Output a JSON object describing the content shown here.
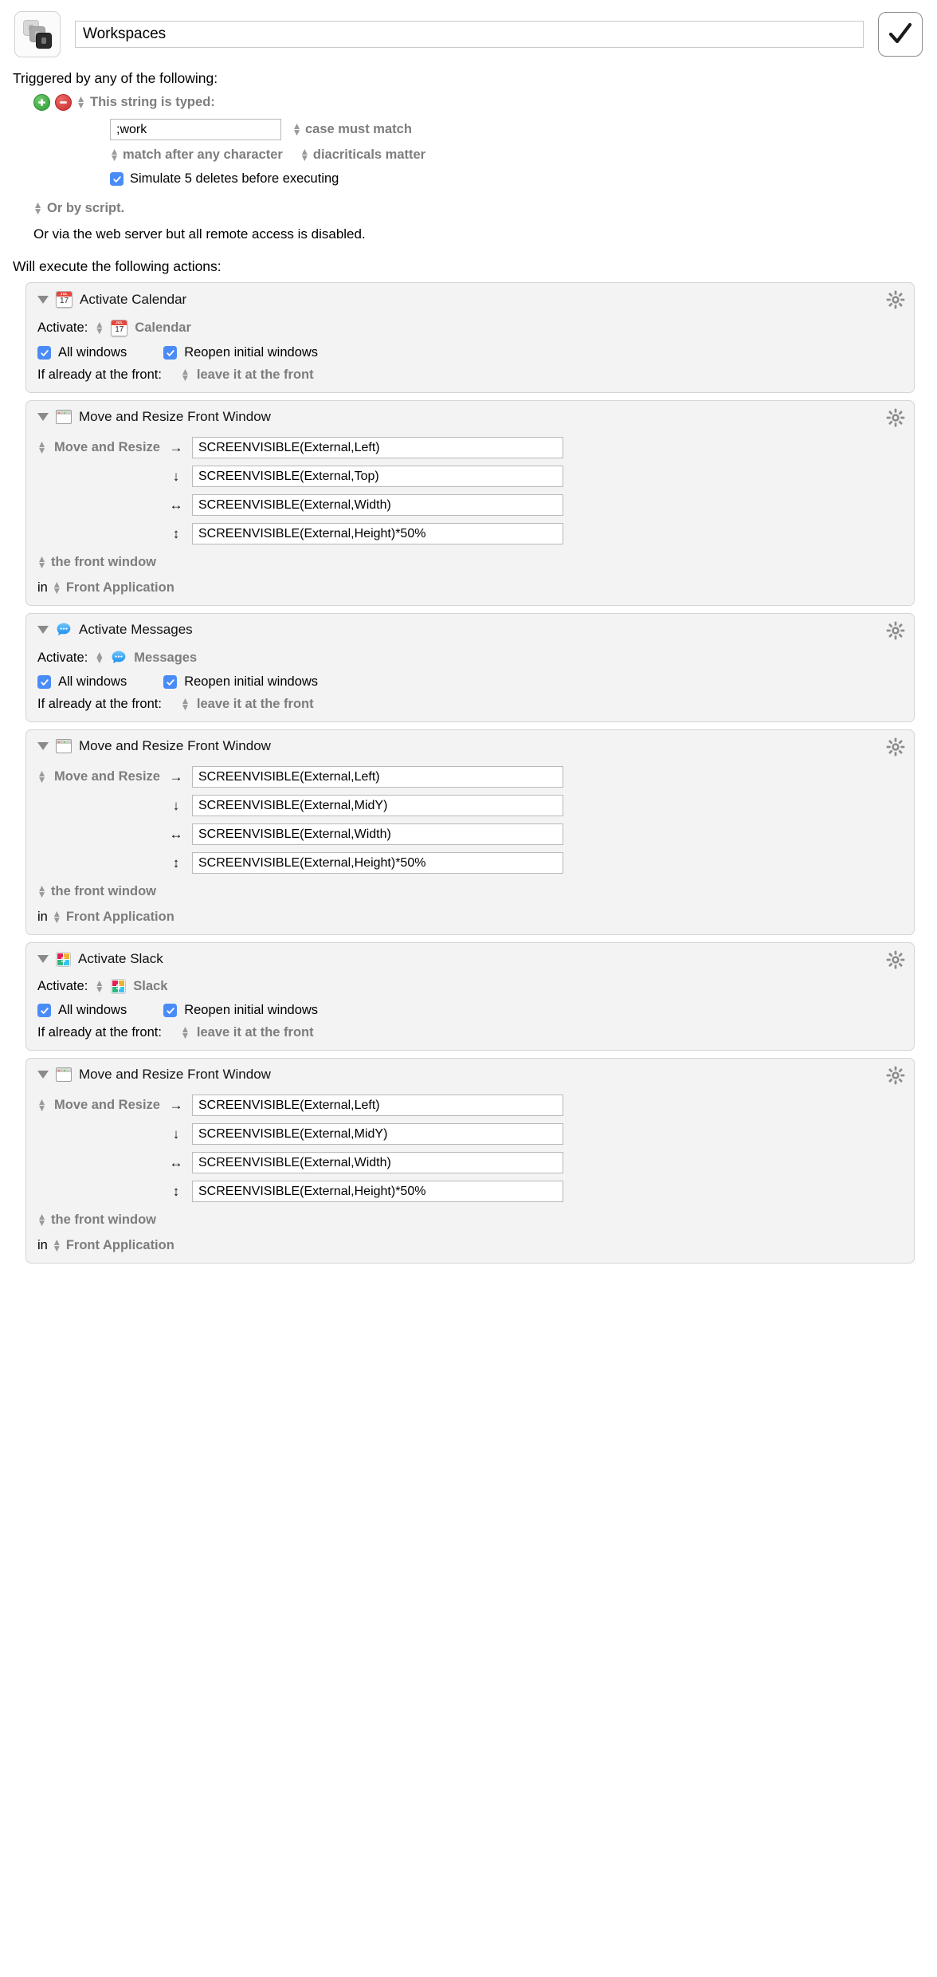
{
  "header": {
    "macro_icon": "macro-keys-icon",
    "title_value": "Workspaces",
    "title_placeholder": "Macro Name",
    "confirm_icon": "checkmark-icon"
  },
  "trigger_section": {
    "heading": "Triggered by any of the following:",
    "add_button": "+",
    "remove_button": "−",
    "trigger_type": "This string is typed:",
    "typed_string": "",
    "typed_string_value": ";work",
    "case_option": "case must match",
    "match_option": "match after any character",
    "diacriticals_option": "diacriticals matter",
    "simulate_deletes": "Simulate 5 deletes before executing",
    "simulate_deletes_checked": true,
    "script_trigger": "Or by script.",
    "web_server_note": "Or via the web server but all remote access is disabled."
  },
  "actions_section": {
    "heading": "Will execute the following actions:",
    "actions": [
      {
        "type": "activate",
        "icon": "calendar-icon",
        "title": "Activate Calendar",
        "activate_label": "Activate:",
        "app_name": "Calendar",
        "all_windows_label": "All windows",
        "all_windows_checked": true,
        "reopen_label": "Reopen initial windows",
        "reopen_checked": true,
        "front_label": "If already at the front:",
        "front_value": "leave it at the front",
        "gear": "gear-icon"
      },
      {
        "type": "move_resize",
        "icon": "window-icon",
        "title": "Move and Resize Front Window",
        "mode_label": "Move and Resize",
        "fields": [
          {
            "arrow": "→",
            "value": "SCREENVISIBLE(External,Left)"
          },
          {
            "arrow": "↓",
            "value": "SCREENVISIBLE(External,Top)"
          },
          {
            "arrow": "↔",
            "value": "SCREENVISIBLE(External,Width)"
          },
          {
            "arrow": "↕",
            "value": "SCREENVISIBLE(External,Height)*50%"
          }
        ],
        "target_label": "the front window",
        "in_label": "in",
        "in_value": "Front Application",
        "gear": "gear-icon"
      },
      {
        "type": "activate",
        "icon": "messages-icon",
        "title": "Activate Messages",
        "activate_label": "Activate:",
        "app_name": "Messages",
        "all_windows_label": "All windows",
        "all_windows_checked": true,
        "reopen_label": "Reopen initial windows",
        "reopen_checked": true,
        "front_label": "If already at the front:",
        "front_value": "leave it at the front",
        "gear": "gear-icon"
      },
      {
        "type": "move_resize",
        "icon": "window-icon",
        "title": "Move and Resize Front Window",
        "mode_label": "Move and Resize",
        "fields": [
          {
            "arrow": "→",
            "value": "SCREENVISIBLE(External,Left)"
          },
          {
            "arrow": "↓",
            "value": "SCREENVISIBLE(External,MidY)"
          },
          {
            "arrow": "↔",
            "value": "SCREENVISIBLE(External,Width)"
          },
          {
            "arrow": "↕",
            "value": "SCREENVISIBLE(External,Height)*50%"
          }
        ],
        "target_label": "the front window",
        "in_label": "in",
        "in_value": "Front Application",
        "gear": "gear-icon"
      },
      {
        "type": "activate",
        "icon": "slack-icon",
        "title": "Activate Slack",
        "activate_label": "Activate:",
        "app_name": "Slack",
        "all_windows_label": "All windows",
        "all_windows_checked": true,
        "reopen_label": "Reopen initial windows",
        "reopen_checked": true,
        "front_label": "If already at the front:",
        "front_value": "leave it at the front",
        "gear": "gear-icon"
      },
      {
        "type": "move_resize",
        "icon": "window-icon",
        "title": "Move and Resize Front Window",
        "mode_label": "Move and Resize",
        "fields": [
          {
            "arrow": "→",
            "value": "SCREENVISIBLE(External,Left)"
          },
          {
            "arrow": "↓",
            "value": "SCREENVISIBLE(External,MidY)"
          },
          {
            "arrow": "↔",
            "value": "SCREENVISIBLE(External,Width)"
          },
          {
            "arrow": "↕",
            "value": "SCREENVISIBLE(External,Height)*50%"
          }
        ],
        "target_label": "the front window",
        "in_label": "in",
        "in_value": "Front Application",
        "gear": "gear-icon"
      }
    ]
  },
  "colors": {
    "checkbox_blue": "#4a8cf7",
    "add_green": "#2f9e34",
    "remove_red": "#cf2a2a",
    "dimmed_label": "#7d7d7d",
    "card_bg": "#f3f3f3",
    "card_border": "#d4d4d4"
  }
}
